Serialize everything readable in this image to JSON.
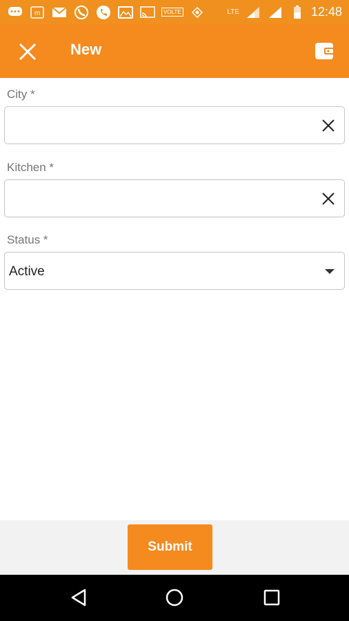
{
  "status_bar": {
    "time": "12:48",
    "network": "LTE",
    "volte": "VOLTE",
    "icons": [
      "chat-icon",
      "m-icon",
      "mail-icon",
      "whatsapp-icon",
      "phone-icon",
      "gallery-icon",
      "cast-icon",
      "volte-icon",
      "data-icon",
      "signal-icon",
      "signal-icon",
      "battery-icon"
    ]
  },
  "app_bar": {
    "title": "New",
    "close_icon": "close-icon",
    "wallet_icon": "wallet-icon"
  },
  "form": {
    "city": {
      "label": "City *",
      "value": ""
    },
    "kitchen": {
      "label": "Kitchen *",
      "value": ""
    },
    "status": {
      "label": "Status *",
      "value": "Active"
    }
  },
  "actions": {
    "submit_label": "Submit"
  },
  "colors": {
    "primary": "#f58a1f",
    "status_bar": "#f0901e",
    "bottom_area": "#f2f2f2",
    "nav_bar": "#000000"
  }
}
